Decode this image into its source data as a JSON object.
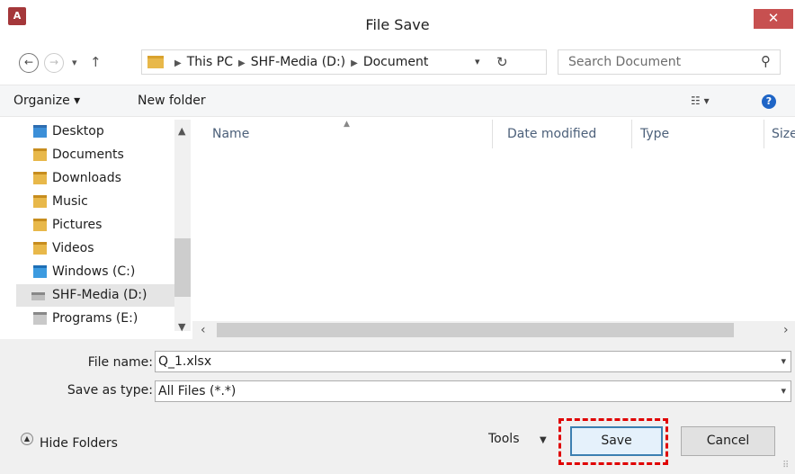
{
  "window": {
    "title": "File Save",
    "app_icon_text": "A",
    "close_glyph": "✕"
  },
  "nav": {
    "back": "←",
    "forward": "→",
    "recent": "▾",
    "up": "↑"
  },
  "address": {
    "crumbs": [
      "This PC",
      "SHF-Media (D:)",
      "Document"
    ],
    "dropdown": "▾",
    "refresh": "↻"
  },
  "search": {
    "placeholder": "Search Document",
    "icon": "⚲"
  },
  "toolbar": {
    "organize": "Organize ▾",
    "new_folder": "New folder",
    "view": "☷ ▾",
    "help": "?"
  },
  "sidebar": {
    "items": [
      {
        "label": "Desktop",
        "icon": "folder-icon"
      },
      {
        "label": "Documents",
        "icon": "folder-icon"
      },
      {
        "label": "Downloads",
        "icon": "folder-icon"
      },
      {
        "label": "Music",
        "icon": "folder-icon"
      },
      {
        "label": "Pictures",
        "icon": "folder-icon"
      },
      {
        "label": "Videos",
        "icon": "folder-icon"
      },
      {
        "label": "Windows (C:)",
        "icon": "drive-icon"
      },
      {
        "label": "SHF-Media (D:)",
        "icon": "drive-icon",
        "selected": true
      },
      {
        "label": "Programs (E:)",
        "icon": "drive-icon"
      }
    ]
  },
  "columns": [
    "Name",
    "Date modified",
    "Type",
    "Size"
  ],
  "file_name": {
    "label": "File name:",
    "value": "Q_1.xlsx"
  },
  "save_type": {
    "label": "Save as type:",
    "value": "All Files (*.*)"
  },
  "footer": {
    "hide_folders": "Hide Folders",
    "tools": "Tools",
    "save": "Save",
    "cancel": "Cancel"
  }
}
